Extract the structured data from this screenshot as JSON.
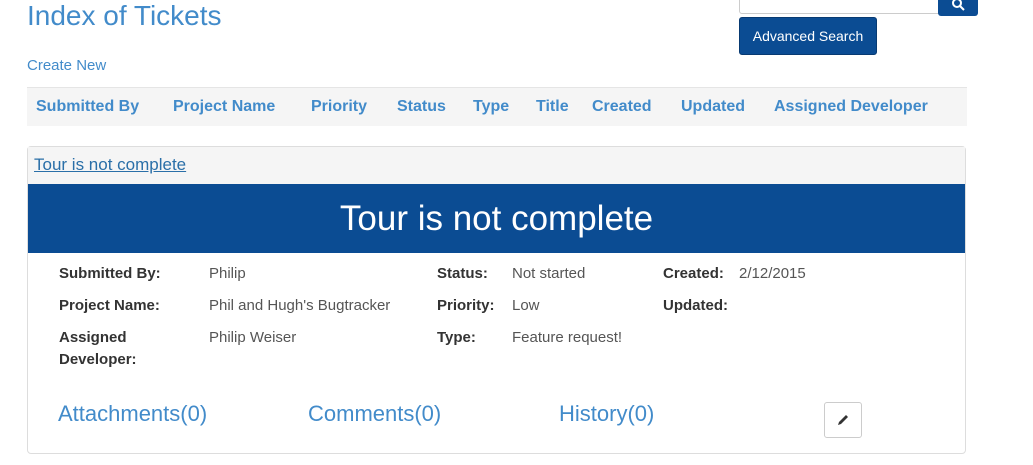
{
  "page": {
    "title": "Index of Tickets",
    "create_link": "Create New"
  },
  "search": {
    "placeholder": "",
    "button_icon": "search-icon",
    "advanced_label": "Advanced Search"
  },
  "table_headers": [
    "Submitted By",
    "Project Name",
    "Priority",
    "Status",
    "Type",
    "Title",
    "Created",
    "Updated",
    "Assigned Developer"
  ],
  "ticket": {
    "link_title": "Tour is not complete",
    "banner_title": "Tour is not complete",
    "submitted_by_label": "Submitted By:",
    "submitted_by": "Philip",
    "project_name_label": "Project Name:",
    "project_name": "Phil and Hugh's Bugtracker",
    "assigned_dev_label_1": "Assigned",
    "assigned_dev_label_2": "Developer:",
    "assigned_dev": "Philip Weiser",
    "status_label": "Status:",
    "status": "Not started",
    "priority_label": "Priority:",
    "priority": "Low",
    "type_label": "Type:",
    "type": "Feature request!",
    "created_label": "Created:",
    "created": "2/12/2015",
    "updated_label": "Updated:",
    "updated": "",
    "attachments": "Attachments(0)",
    "comments": "Comments(0)",
    "history": "History(0)",
    "edit_icon": "pencil-icon"
  },
  "colors": {
    "primary": "#0b4c93",
    "link": "#428bca"
  }
}
